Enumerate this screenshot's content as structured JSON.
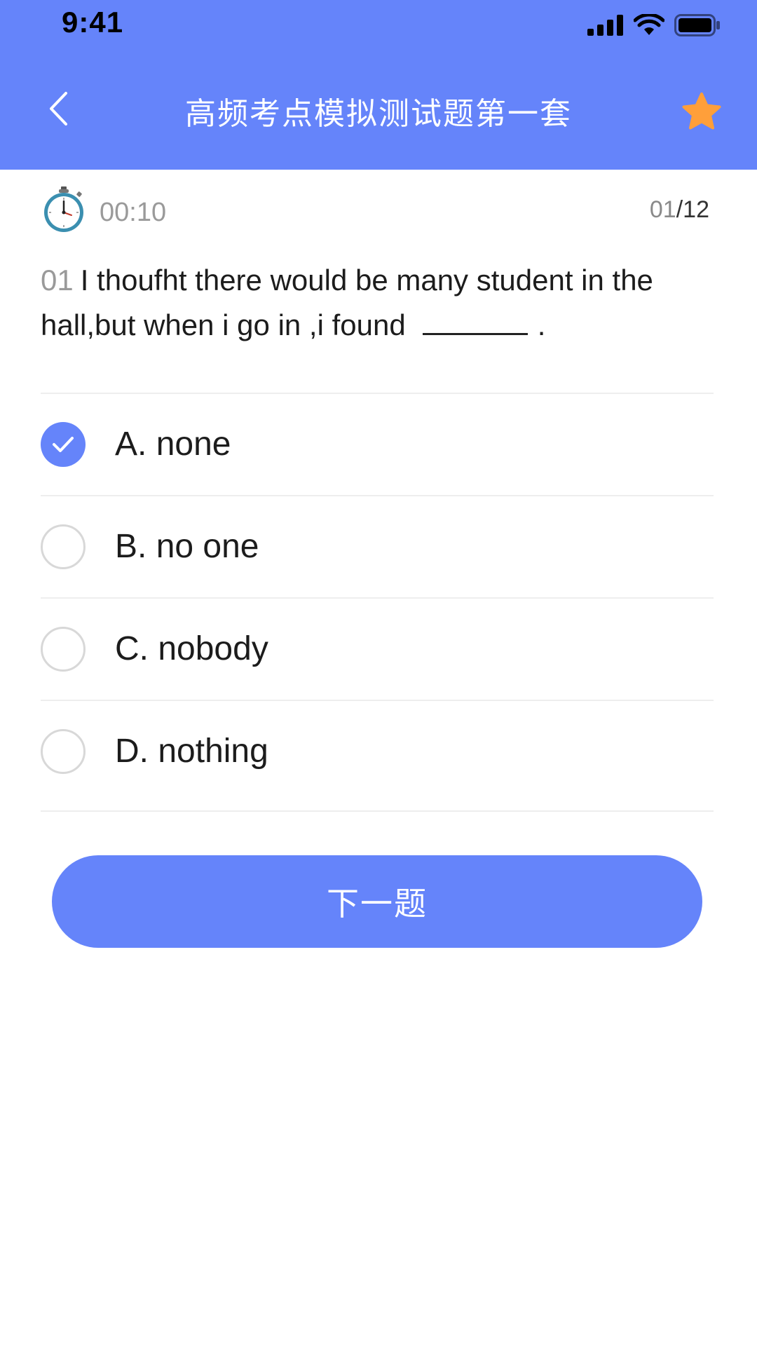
{
  "status_bar": {
    "time": "9:41"
  },
  "header": {
    "title": "高频考点模拟测试题第一套"
  },
  "timer": {
    "elapsed": "00:10"
  },
  "progress": {
    "current": "01",
    "separator": "/",
    "total": "12"
  },
  "question": {
    "number": "01",
    "text_before_blank": "I thoufht there would be many student in the hall,but when i go in ,i found",
    "text_after_blank": "."
  },
  "options": [
    {
      "label": "A. none",
      "selected": true
    },
    {
      "label": "B. no one",
      "selected": false
    },
    {
      "label": "C. nobody",
      "selected": false
    },
    {
      "label": "D. nothing",
      "selected": false
    }
  ],
  "next_button": {
    "label": "下一题"
  },
  "colors": {
    "primary": "#6584FA",
    "star": "#FF9F3A"
  }
}
